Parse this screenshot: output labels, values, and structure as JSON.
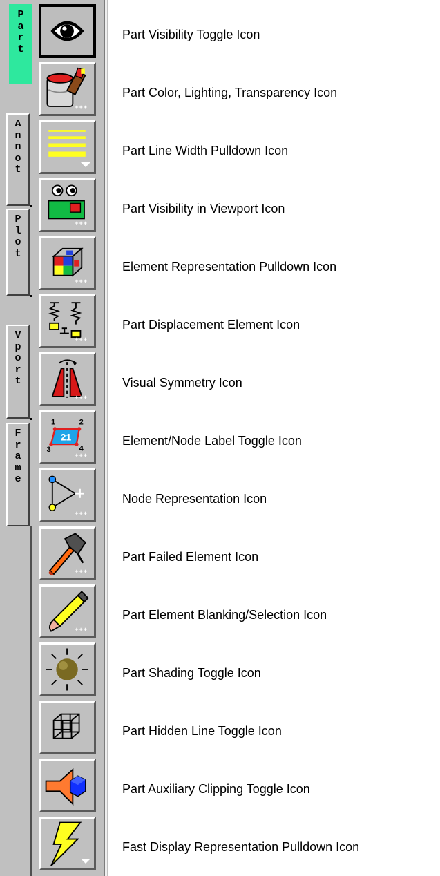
{
  "tabs": [
    {
      "label": "P\na\nr\nt",
      "active": true
    },
    {
      "label": "A\nn\nn\no\nt",
      "active": false
    },
    {
      "label": "P\nl\no\nt",
      "active": false
    },
    {
      "label": "V\np\no\nr\nt",
      "active": false
    },
    {
      "label": "F\nr\na\nm\ne",
      "active": false
    }
  ],
  "toolbar_buttons": [
    {
      "icon": "eye-icon",
      "label": "Part Visibility Toggle Icon",
      "indicator": "",
      "pressed": true
    },
    {
      "icon": "paint-can-brush-icon",
      "label": "Part Color, Lighting, Transparency Icon",
      "indicator": "+++"
    },
    {
      "icon": "line-width-icon",
      "label": "Part Line Width Pulldown Icon",
      "indicator": "pulldown"
    },
    {
      "icon": "eyes-viewport-icon",
      "label": "Part Visibility in Viewport Icon",
      "indicator": "+++"
    },
    {
      "icon": "colored-cube-icon",
      "label": "Element Representation Pulldown Icon",
      "indicator": "+++"
    },
    {
      "icon": "springs-icon",
      "label": "Part Displacement Element Icon",
      "indicator": "+++"
    },
    {
      "icon": "symmetry-icon",
      "label": "Visual Symmetry Icon",
      "indicator": "+++"
    },
    {
      "icon": "element-labels-icon",
      "label": "Element/Node Label Toggle Icon",
      "indicator": "+++"
    },
    {
      "icon": "node-triangle-icon",
      "label": "Node Representation Icon",
      "indicator": "+++"
    },
    {
      "icon": "hammer-icon",
      "label": "Part Failed Element Icon",
      "indicator": "+++"
    },
    {
      "icon": "pencil-icon",
      "label": "Part Element Blanking/Selection Icon",
      "indicator": "+++"
    },
    {
      "icon": "sun-shading-icon",
      "label": "Part Shading Toggle Icon",
      "indicator": ""
    },
    {
      "icon": "wireframe-cube-icon",
      "label": "Part Hidden Line Toggle Icon",
      "indicator": ""
    },
    {
      "icon": "clipping-icon",
      "label": "Part Auxiliary Clipping Toggle Icon",
      "indicator": ""
    },
    {
      "icon": "lightning-icon",
      "label": "Fast Display Representation Pulldown Icon",
      "indicator": "pulldown"
    }
  ],
  "icon_text": {
    "label_nums": [
      "1",
      "2",
      "3",
      "4"
    ],
    "label_center": "21"
  },
  "colors": {
    "active_tab": "#2ee89e",
    "panel": "#c0c0c0",
    "accent_red": "#e02020",
    "accent_yellow": "#ffff20"
  }
}
